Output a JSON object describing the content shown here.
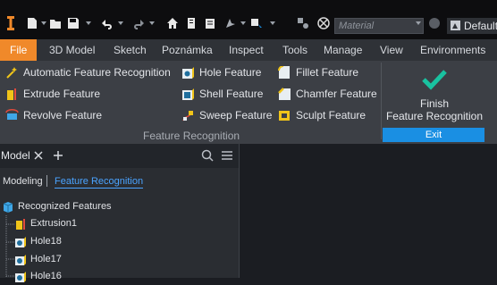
{
  "quick_access": {
    "material_placeholder": "Material",
    "appearance_value": "Default"
  },
  "menu": {
    "tabs": [
      "File",
      "3D Model",
      "Sketch",
      "Poznámka",
      "Inspect",
      "Tools",
      "Manage",
      "View",
      "Environments"
    ]
  },
  "ribbon": {
    "col1": [
      "Automatic Feature Recognition",
      "Extrude Feature",
      "Revolve Feature"
    ],
    "col2": [
      "Hole Feature",
      "Shell Feature",
      "Sweep Feature"
    ],
    "col3": [
      "Fillet Feature",
      "Chamfer Feature",
      "Sculpt Feature"
    ],
    "group_label": "Feature Recognition",
    "finish_line1": "Finish",
    "finish_line2": "Feature Recognition",
    "exit_label": "Exit"
  },
  "browser": {
    "tab_label": "Model",
    "mode_modeling": "Modeling",
    "mode_feature": "Feature Recognition",
    "tree": {
      "root": "Recognized Features",
      "items": [
        "Extrusion1",
        "Hole18",
        "Hole17",
        "Hole16"
      ]
    }
  },
  "colors": {
    "accent_orange": "#f0892a",
    "exit_blue": "#1a8fe3",
    "link_blue": "#4aa3ff",
    "check_teal": "#19c2a0"
  }
}
